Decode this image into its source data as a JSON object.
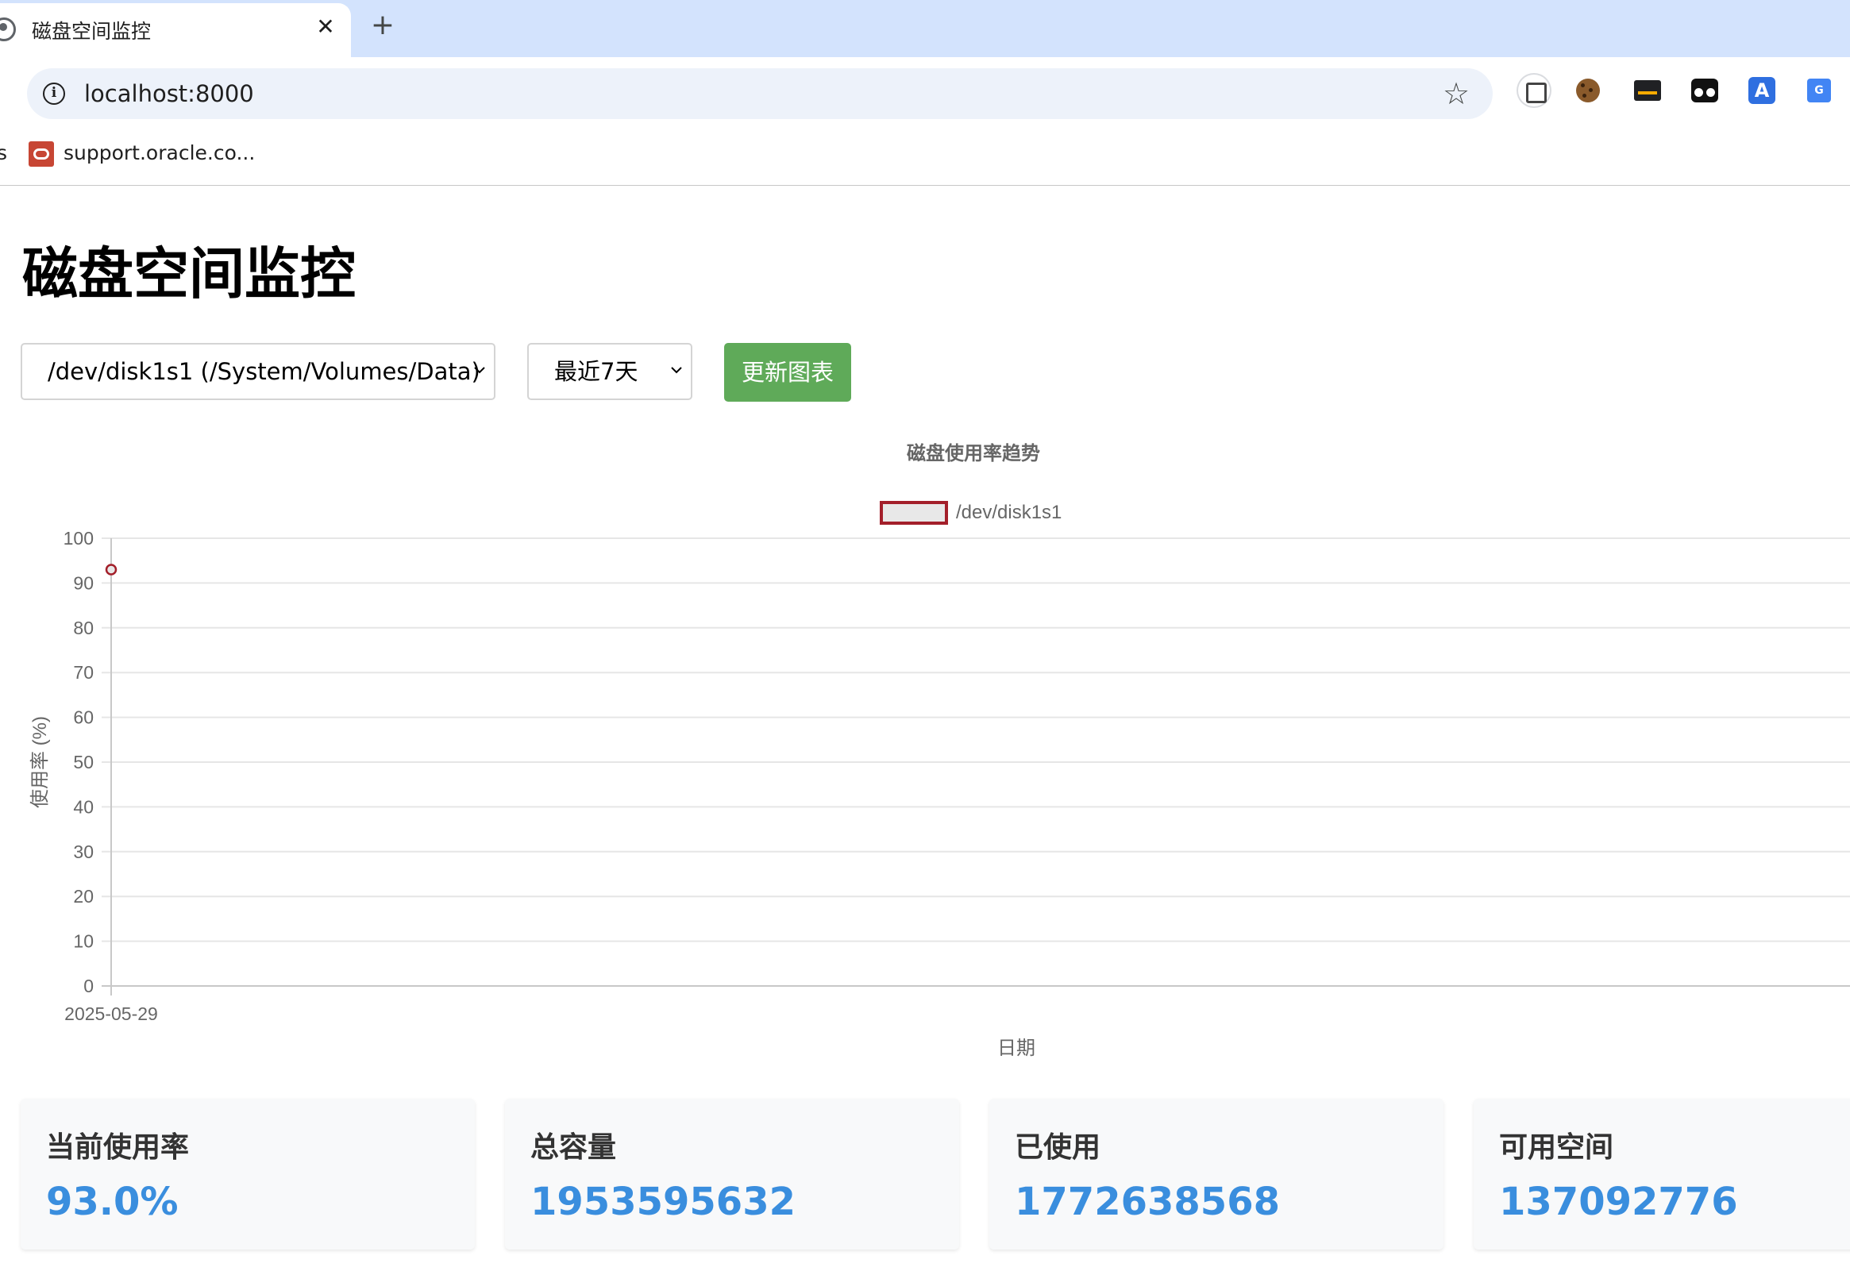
{
  "browser": {
    "tab_title": "磁盘空间监控",
    "tab_close": "✕",
    "new_tab": "+",
    "url": "localhost:8000",
    "bookmarks": [
      {
        "label": "s"
      },
      {
        "label": "support.oracle.co..."
      }
    ]
  },
  "page": {
    "title": "磁盘空间监控",
    "disk_select": {
      "selected": "/dev/disk1s1 (/System/Volumes/Data)"
    },
    "range_select": {
      "selected": "最近7天"
    },
    "update_button": "更新图表"
  },
  "chart_data": {
    "type": "line",
    "title": "磁盘使用率趋势",
    "xlabel": "日期",
    "ylabel": "使用率 (%)",
    "ylim": [
      0,
      100
    ],
    "yticks": [
      0,
      10,
      20,
      30,
      40,
      50,
      60,
      70,
      80,
      90,
      100
    ],
    "categories": [
      "2025-05-29"
    ],
    "series": [
      {
        "name": "/dev/disk1s1",
        "values": [
          93.0
        ],
        "color": "#a31f2a",
        "fill": "#e8e8e8"
      }
    ],
    "legend_position": "top-center",
    "grid": true
  },
  "stats": [
    {
      "label": "当前使用率",
      "value": "93.0%"
    },
    {
      "label": "总容量",
      "value": "1953595632"
    },
    {
      "label": "已使用",
      "value": "1772638568"
    },
    {
      "label": "可用空间",
      "value": "137092776"
    }
  ],
  "colors": {
    "accent_green": "#5faa59",
    "stat_blue": "#3a8ede",
    "series_red": "#a31f2a"
  }
}
